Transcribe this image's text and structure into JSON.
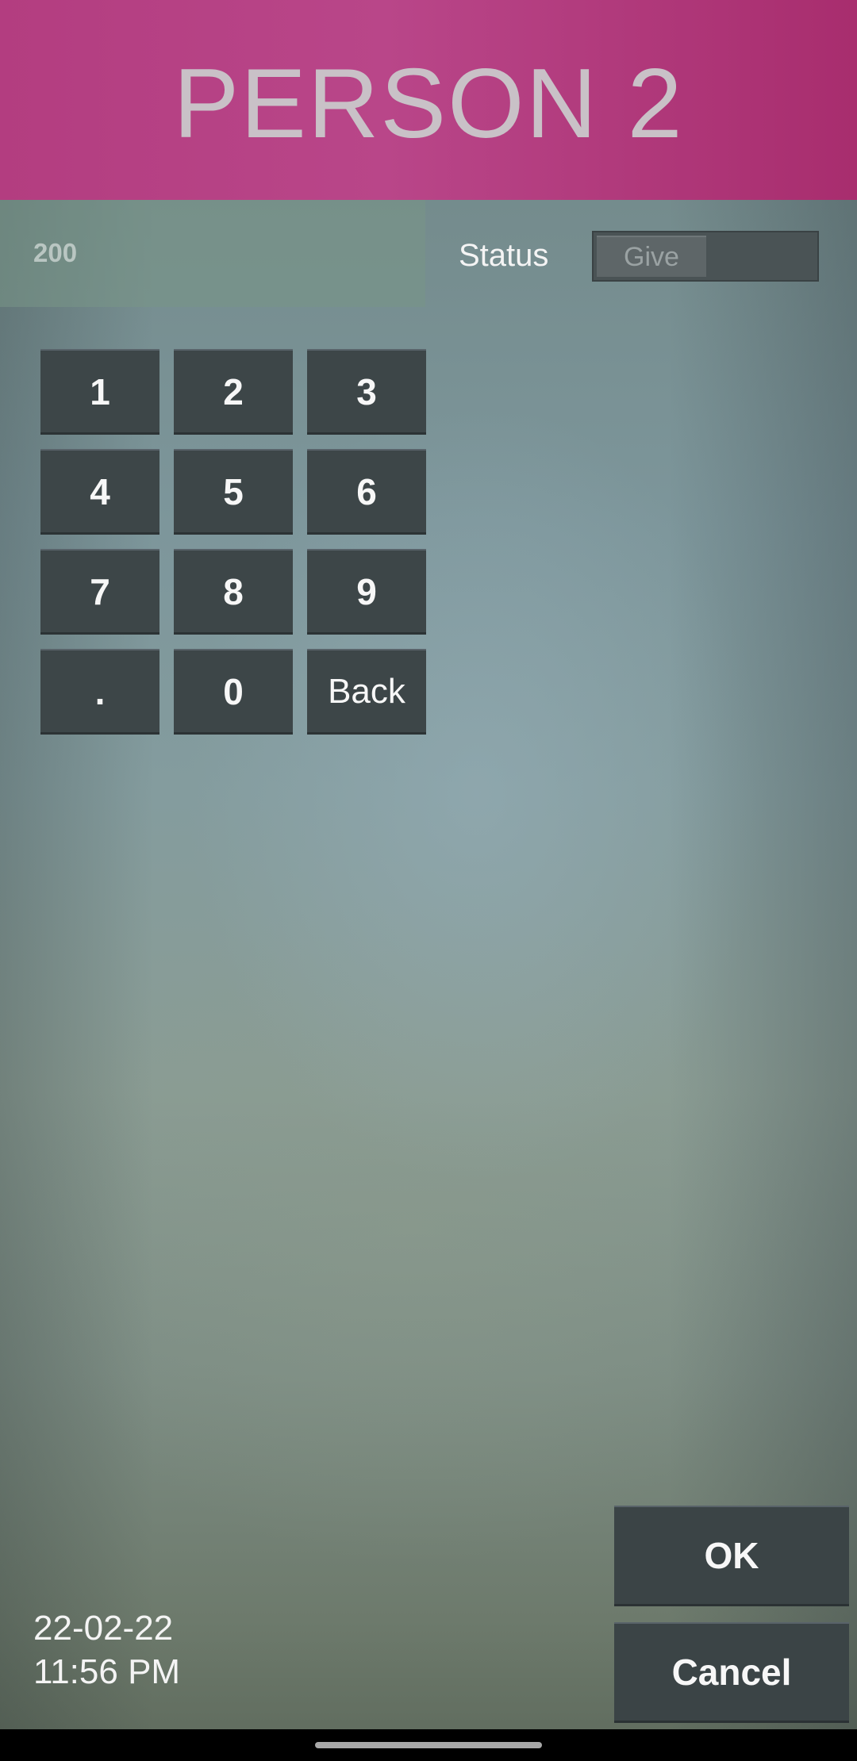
{
  "header": {
    "title": "PERSON 2"
  },
  "amount": {
    "value": "200"
  },
  "status": {
    "label": "Status",
    "toggle_value": "Give"
  },
  "keypad": {
    "keys": [
      "1",
      "2",
      "3",
      "4",
      "5",
      "6",
      "7",
      "8",
      "9",
      ".",
      "0",
      "Back"
    ]
  },
  "footer": {
    "date": "22-02-22",
    "time": "11:56 PM"
  },
  "actions": {
    "ok_label": "OK",
    "cancel_label": "Cancel"
  },
  "colors": {
    "header_bg": "#b33d80",
    "header_text": "#c9c1c7",
    "button_bg": "#3d4648",
    "button_text": "#f7f7f7"
  }
}
